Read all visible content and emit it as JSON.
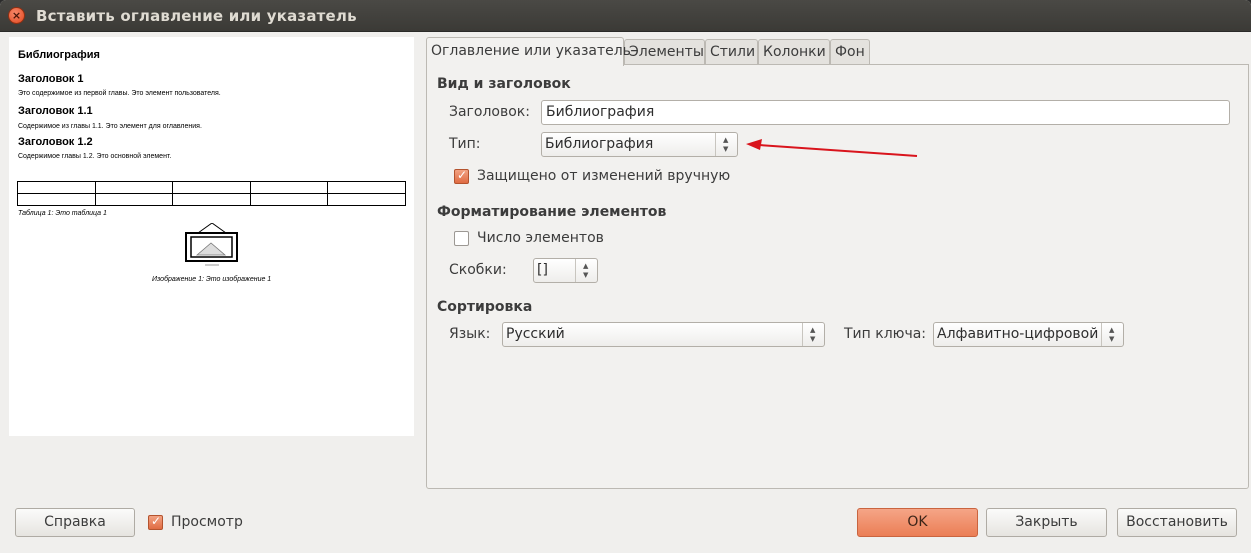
{
  "window": {
    "title": "Вставить оглавление или указатель"
  },
  "preview": {
    "title": "Библиография",
    "headings": [
      {
        "heading": "Заголовок 1",
        "body": "Это содержимое из первой главы. Это элемент пользователя."
      },
      {
        "heading": "Заголовок 1.1",
        "body": "Содержимое из главы 1.1. Это элемент для оглавления."
      },
      {
        "heading": "Заголовок 1.2",
        "body": "Содержимое главы 1.2. Это основной элемент."
      }
    ],
    "table_caption": "Таблица 1: Это таблица 1",
    "image_caption": "Изображение 1: Это изображение 1"
  },
  "tabs": [
    {
      "label": "Оглавление или указатель",
      "active": true
    },
    {
      "label": "Элементы"
    },
    {
      "label": "Стили"
    },
    {
      "label": "Колонки"
    },
    {
      "label": "Фон"
    }
  ],
  "type_and_title": {
    "section_label": "Вид и заголовок",
    "title_label": "Заголовок:",
    "title_value": "Библиография",
    "type_label": "Тип:",
    "type_value": "Библиография",
    "protected_label": "Защищено от изменений вручную",
    "protected_checked": true
  },
  "entries_format": {
    "section_label": "Форматирование элементов",
    "number_entries_label": "Число элементов",
    "number_entries_checked": false,
    "brackets_label": "Скобки:",
    "brackets_value": "[]"
  },
  "sort": {
    "section_label": "Сортировка",
    "language_label": "Язык:",
    "language_value": "Русский",
    "key_type_label": "Тип ключа:",
    "key_type_value": "Алфавитно-цифровой"
  },
  "footer": {
    "help_label": "Справка",
    "preview_label": "Просмотр",
    "preview_checked": true,
    "ok_label": "OK",
    "close_label": "Закрыть",
    "reset_label": "Восстановить"
  },
  "colors": {
    "accent": "#e97a50",
    "annotation_arrow": "#d9141c"
  }
}
